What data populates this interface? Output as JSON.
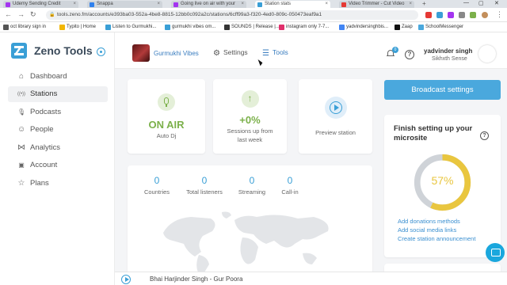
{
  "browser": {
    "tabs": [
      {
        "label": "Udemy Sending Credit",
        "color": "#a435f0"
      },
      {
        "label": "Snappa",
        "color": "#2f80ed"
      },
      {
        "label": "Going live on air with your",
        "color": "#a435f0"
      },
      {
        "label": "Station stats",
        "color": "#3a9fd6"
      },
      {
        "label": "Video Trimmer - Cut Video",
        "color": "#e53935"
      }
    ],
    "url": "tools.zeno.fm/accounts/e393ba03-552a-4be8-8815-12bb0c092a2c/stations/6cff99a3-f320-4ed0-809c-050473eaf9a1",
    "bookmarks": [
      {
        "label": "oct library sign in",
        "color": "#555555"
      },
      {
        "label": "Typito | Home",
        "color": "#f2b705"
      },
      {
        "label": "Listen to Gurmukhi...",
        "color": "#3a9fd6"
      },
      {
        "label": "gurmukhi vibes om...",
        "color": "#3a9fd6"
      },
      {
        "label": "SOUNDS | Release |...",
        "color": "#333333"
      },
      {
        "label": "instagram only 7-7...",
        "color": "#e1306c"
      },
      {
        "label": "yadvindersinghbis...",
        "color": "#4285f4"
      },
      {
        "label": "Zaap",
        "color": "#111111"
      },
      {
        "label": "SchoolMessenger",
        "color": "#4aa8dd"
      }
    ]
  },
  "sidebar": {
    "brand": "Zeno Tools",
    "items": [
      {
        "label": "Dashboard",
        "icon": "home-icon",
        "glyph": "⌂"
      },
      {
        "label": "Stations",
        "icon": "radio-icon",
        "glyph": "((•))"
      },
      {
        "label": "Podcasts",
        "icon": "mic-icon",
        "glyph": "🎙"
      },
      {
        "label": "People",
        "icon": "person-icon",
        "glyph": "☺"
      },
      {
        "label": "Analytics",
        "icon": "share-icon",
        "glyph": "⋈"
      },
      {
        "label": "Account",
        "icon": "account-icon",
        "glyph": "▣"
      },
      {
        "label": "Plans",
        "icon": "star-icon",
        "glyph": "☆"
      }
    ]
  },
  "topbar": {
    "station_name": "Gurmukhi Vibes",
    "settings_label": "Settings",
    "tools_label": "Tools",
    "notification_count": "0",
    "user_name": "yadvinder singh",
    "user_sub": "Sikhxth Sense"
  },
  "stats": {
    "onair": {
      "value": "ON AIR",
      "label": "Auto Dj"
    },
    "sessions": {
      "value": "+0%",
      "label_line1": "Sessions up from",
      "label_line2": "last week"
    },
    "preview": {
      "label": "Preview station"
    }
  },
  "metrics": [
    {
      "value": "0",
      "label": "Countries"
    },
    {
      "value": "0",
      "label": "Total listeners"
    },
    {
      "value": "0",
      "label": "Streaming"
    },
    {
      "value": "0",
      "label": "Call-in"
    }
  ],
  "broadcast_button": "Broadcast settings",
  "microsite": {
    "title": "Finish setting up your microsite",
    "percent_label": "57%",
    "progress": 0.57,
    "links": [
      "Add donations methods",
      "Add social media links",
      "Create station announcement"
    ]
  },
  "player": {
    "title": "Bhai Harjinder Singh - Gur Poora"
  },
  "colors": {
    "accent": "#3a9fd6",
    "green": "#7bb04a",
    "progress_yellow": "#e9c63f"
  }
}
